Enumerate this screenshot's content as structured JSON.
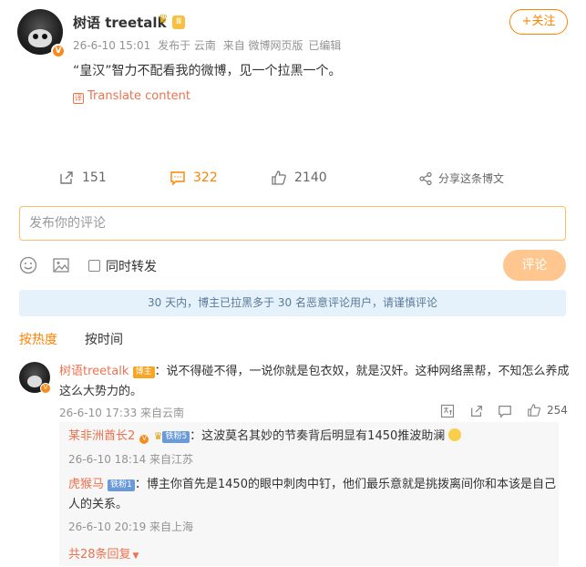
{
  "post": {
    "username": "树语 treetalk",
    "level_badge": "Ⅲ",
    "vip_badge": "V",
    "timestamp": "26-6-10 15:01",
    "location": "发布于 云南",
    "source": "来自 微博网页版",
    "edited": "已编辑",
    "follow_label": "+关注",
    "text": "“皇汉”智力不配看我的微博，见一个拉黑一个。",
    "translate_label": "Translate content",
    "translate_icon": "译"
  },
  "actions": {
    "repost_count": "151",
    "comment_count": "322",
    "like_count": "2140",
    "share_label": "分享这条博文"
  },
  "comment_box": {
    "placeholder": "发布你的评论",
    "repost_checkbox_label": "同时转发",
    "submit_label": "评论"
  },
  "notice": "30 天内，博主已拉黑多于 30 名恶意评论用户，请谨慎评论",
  "sort_tabs": [
    "按热度",
    "按时间"
  ],
  "comments": [
    {
      "name": "树语treetalk",
      "badge": "博主",
      "text": "：说不得碰不得，一说你就是包衣奴，就是汉奸。这种网络黑帮，不知怎么养成这么大势力的。",
      "timestamp": "26-6-10 17:33 来自云南",
      "likes": "254",
      "replies": [
        {
          "name": "某非洲酋长2",
          "badge": "铁粉5",
          "text": "：这波莫名其妙的节奏背后明显有1450推波助澜",
          "timestamp": "26-6-10 18:14 来自江苏"
        },
        {
          "name": "虎猴马",
          "badge": "铁粉1",
          "text": "：博主你首先是1450的眼中刺肉中钉，他们最乐意就是挑拨离间你和本该是自己人的关系。",
          "timestamp": "26-6-10 20:19 来自上海"
        }
      ],
      "more_replies": "共28条回复"
    }
  ]
}
